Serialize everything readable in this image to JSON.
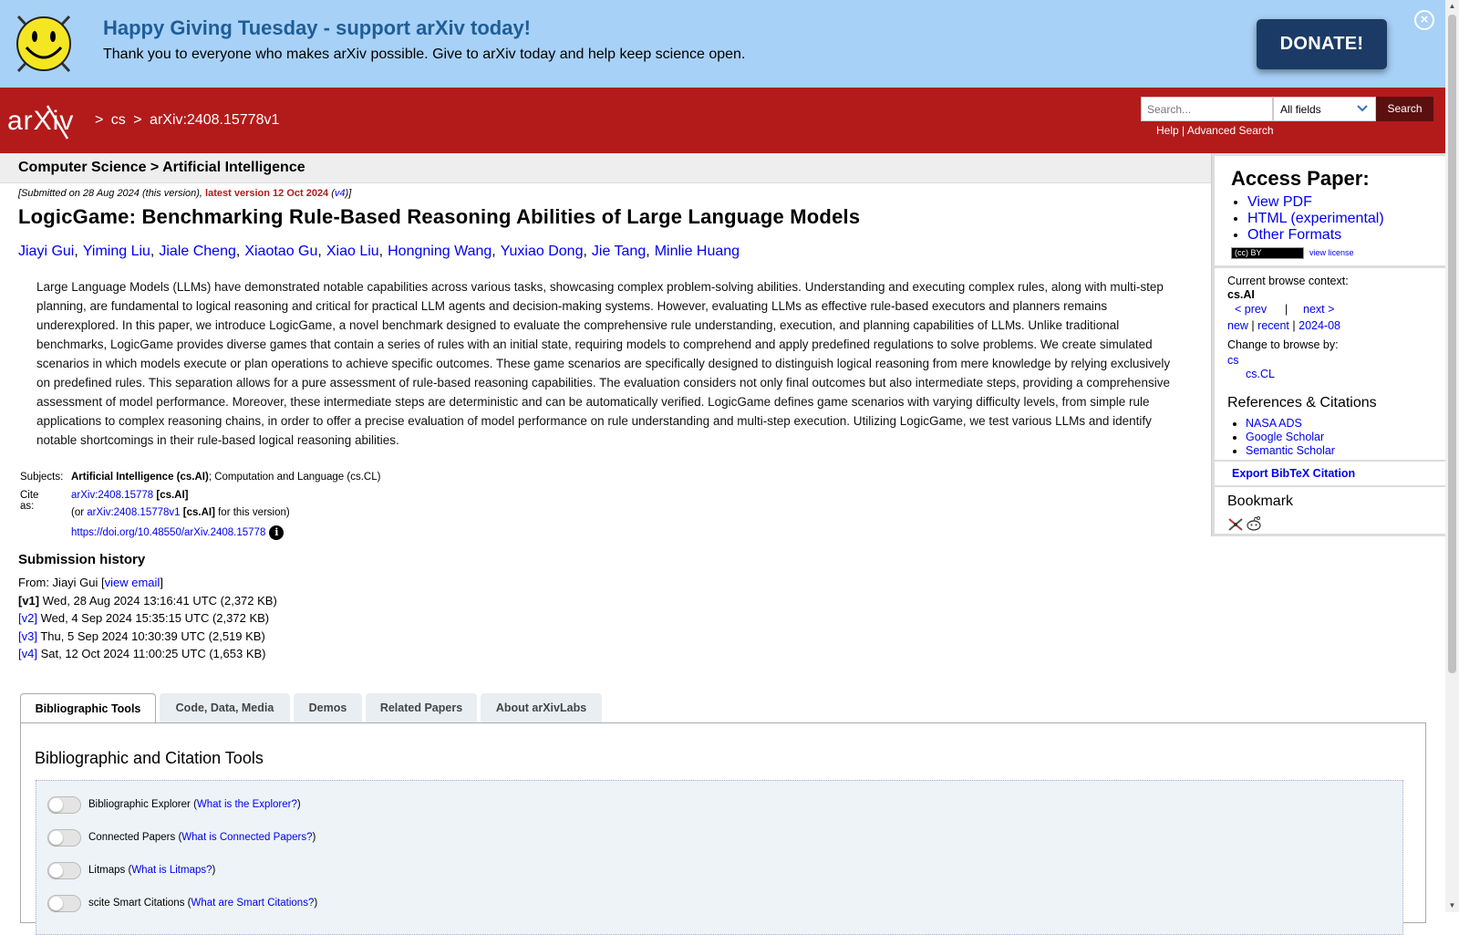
{
  "banner": {
    "title": "Happy Giving Tuesday - support arXiv today!",
    "text": "Thank you to everyone who makes arXiv possible. Give to arXiv today and help keep science open.",
    "donate_label": "DONATE!",
    "close_icon": "close-circle-icon",
    "close_glyph": "×"
  },
  "header": {
    "logo_text": "arXiv",
    "breadcrumb": [
      ">",
      "cs",
      ">",
      "arXiv:2408.15778v1"
    ],
    "search_placeholder": "Search...",
    "search_field": "All fields",
    "search_button": "Search",
    "help": "Help",
    "sep": "|",
    "advanced": "Advanced Search",
    "accent_color": "#b31b1b"
  },
  "subheader": "Computer Science > Artificial Intelligence",
  "dateline": {
    "submitted": "[Submitted on 28 Aug 2024 (this version), ",
    "latest": "latest version 12 Oct 2024",
    "open": " (",
    "v4": "v4",
    "close": ")]"
  },
  "paper": {
    "title": "LogicGame: Benchmarking Rule-Based Reasoning Abilities of Large Language Models",
    "authors": [
      "Jiayi Gui",
      "Yiming Liu",
      "Jiale Cheng",
      "Xiaotao Gu",
      "Xiao Liu",
      "Hongning Wang",
      "Yuxiao Dong",
      "Jie Tang",
      "Minlie Huang"
    ],
    "author_sep": ",",
    "abstract": "Large Language Models (LLMs) have demonstrated notable capabilities across various tasks, showcasing complex problem-solving abilities. Understanding and executing complex rules, along with multi-step planning, are fundamental to logical reasoning and critical for practical LLM agents and decision-making systems. However, evaluating LLMs as effective rule-based executors and planners remains underexplored. In this paper, we introduce LogicGame, a novel benchmark designed to evaluate the comprehensive rule understanding, execution, and planning capabilities of LLMs. Unlike traditional benchmarks, LogicGame provides diverse games that contain a series of rules with an initial state, requiring models to comprehend and apply predefined regulations to solve problems. We create simulated scenarios in which models execute or plan operations to achieve specific outcomes. These game scenarios are specifically designed to distinguish logical reasoning from mere knowledge by relying exclusively on predefined rules. This separation allows for a pure assessment of rule-based reasoning capabilities. The evaluation considers not only final outcomes but also intermediate steps, providing a comprehensive assessment of model performance. Moreover, these intermediate steps are deterministic and can be automatically verified. LogicGame defines game scenarios with varying difficulty levels, from simple rule applications to complex reasoning chains, in order to offer a precise evaluation of model performance on rule understanding and multi-step execution. Utilizing LogicGame, we test various LLMs and identify notable shortcomings in their rule-based logical reasoning abilities."
  },
  "meta": {
    "subjects_label": "Subjects:",
    "subjects_primary": "Artificial Intelligence (cs.AI)",
    "subjects_rest": "; Computation and Language (cs.CL)",
    "cite_label": "Cite as:",
    "cite_id": "arXiv:2408.15778",
    "cite_cat": "[cs.AI]",
    "or_pre": "(or ",
    "or_id": "arXiv:2408.15778v1",
    "or_cat": "[cs.AI]",
    "or_post": " for this version)",
    "doi": "https://doi.org/10.48550/arXiv.2408.15778",
    "info_icon": "info-icon",
    "info_glyph": "i"
  },
  "history": {
    "heading": "Submission history",
    "from_pre": "From: Jiayi Gui [",
    "view_email": "view email",
    "from_post": "]",
    "versions": [
      {
        "label": "[v1]",
        "text": "Wed, 28 Aug 2024 13:16:41 UTC (2,372 KB)",
        "link": false
      },
      {
        "label": "[v2]",
        "text": "Wed, 4 Sep 2024 15:35:15 UTC (2,372 KB)",
        "link": true
      },
      {
        "label": "[v3]",
        "text": "Thu, 5 Sep 2024 10:30:39 UTC (2,519 KB)",
        "link": true
      },
      {
        "label": "[v4]",
        "text": "Sat, 12 Oct 2024 11:00:25 UTC (1,653 KB)",
        "link": true
      }
    ]
  },
  "tabs": [
    "Bibliographic Tools",
    "Code, Data, Media",
    "Demos",
    "Related Papers",
    "About arXivLabs"
  ],
  "tools": {
    "heading": "Bibliographic and Citation Tools",
    "rows": [
      {
        "name": "Bibliographic Explorer",
        "pre": " (",
        "link": "What is the Explorer?",
        "post": ")"
      },
      {
        "name": "Connected Papers",
        "pre": " (",
        "link": "What is Connected Papers?",
        "post": ")"
      },
      {
        "name": "Litmaps",
        "pre": " (",
        "link": "What is Litmaps?",
        "post": ")"
      },
      {
        "name": "scite Smart Citations",
        "pre": " (",
        "link": "What are Smart Citations?",
        "post": ")"
      }
    ]
  },
  "sidebar": {
    "access_heading": "Access Paper:",
    "access_links": [
      "View PDF",
      "HTML (experimental)",
      "Other Formats"
    ],
    "license_badge": "(cc) BY",
    "view_license": "view license",
    "browse_label": "Current browse context:",
    "browse_context": "cs.AI",
    "prev": "< prev",
    "pipe": "|",
    "next": "next >",
    "new": "new",
    "recent": "recent",
    "month": "2024-08",
    "change_label": "Change to browse by:",
    "cs": "cs",
    "cscl": "cs.CL",
    "refs_heading": "References & Citations",
    "refs": [
      "NASA ADS",
      "Google Scholar",
      "Semantic Scholar"
    ],
    "export": "Export BibTeX Citation",
    "bookmark_heading": "Bookmark",
    "bookmark_icons": [
      "bibsonomy-icon",
      "reddit-icon"
    ]
  }
}
